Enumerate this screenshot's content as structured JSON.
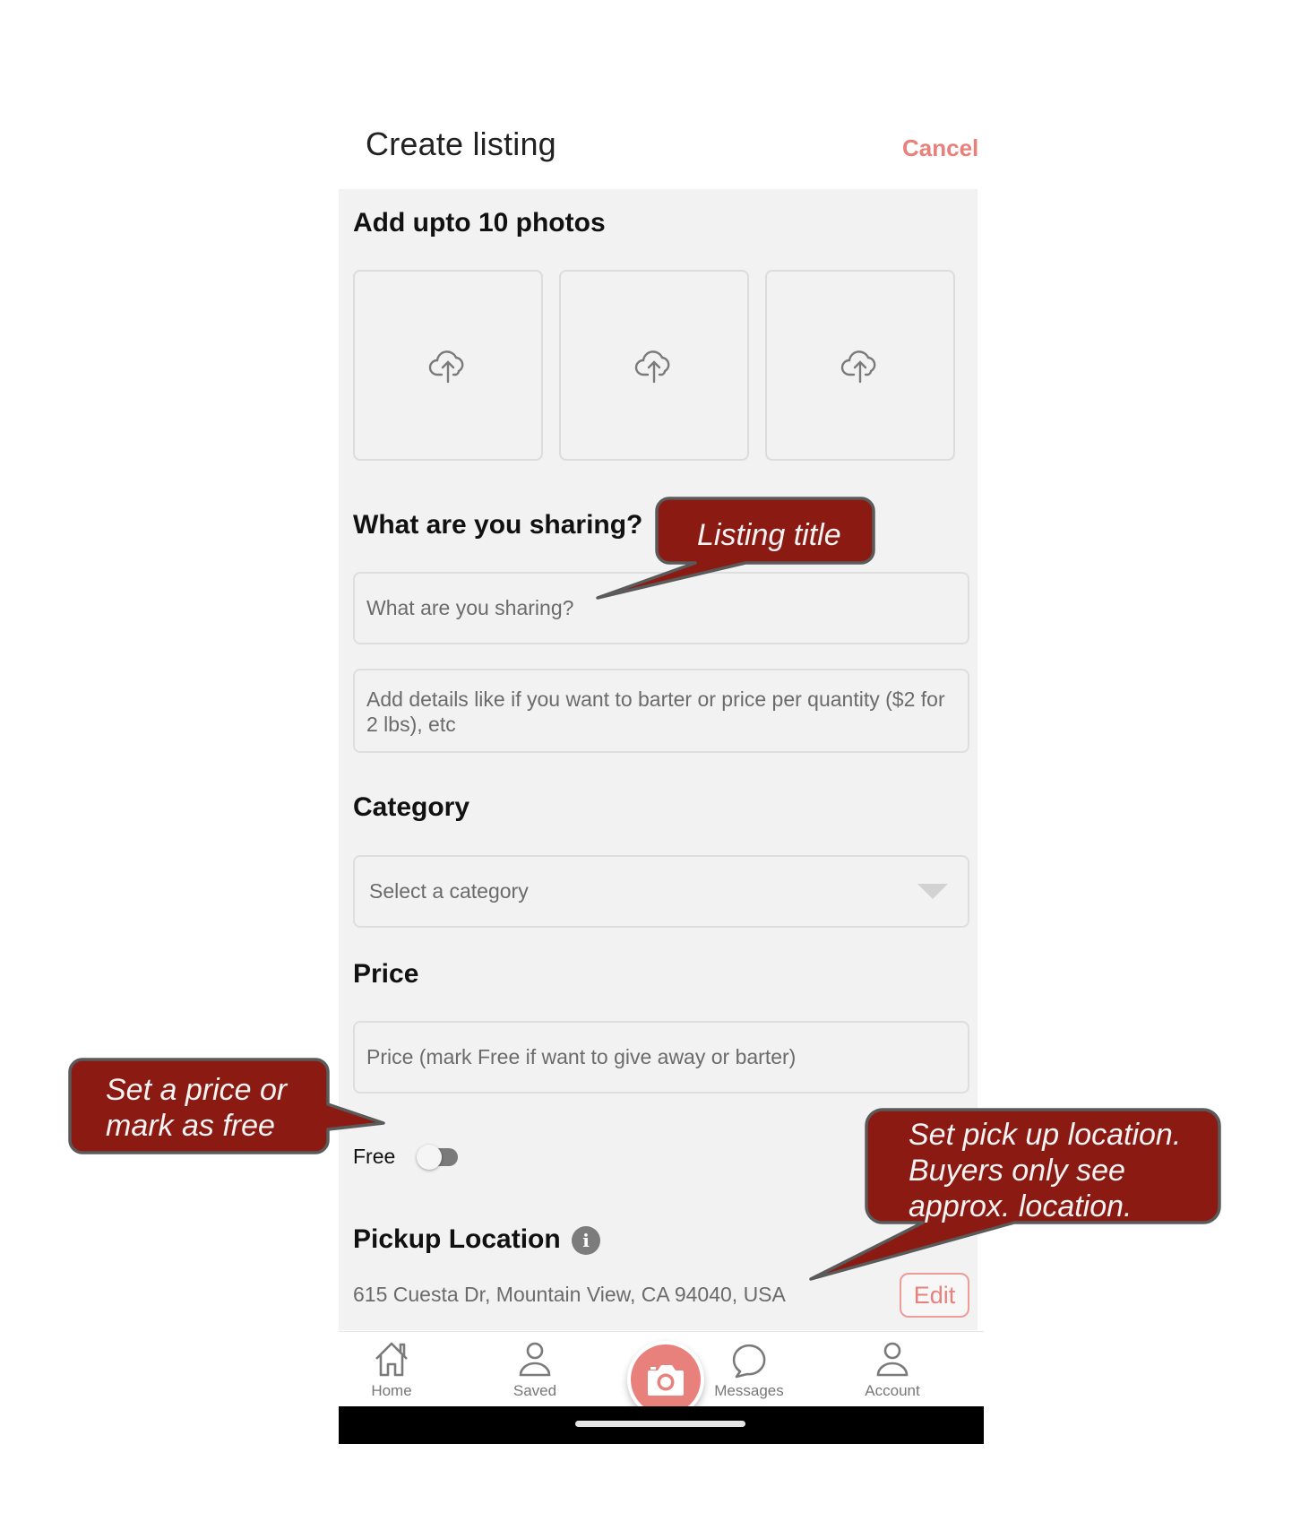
{
  "header": {
    "title": "Create listing",
    "cancel_label": "Cancel"
  },
  "photos": {
    "title": "Add upto 10 photos",
    "slots": [
      {
        "icon": "cloud-upload-icon"
      },
      {
        "icon": "cloud-upload-icon"
      },
      {
        "icon": "cloud-upload-icon"
      }
    ]
  },
  "sharing": {
    "title": "What are you sharing?",
    "title_input_placeholder": "What are you sharing?",
    "details_input_placeholder": "Add details like if you want to barter or price per quantity ($2 for 2 lbs), etc"
  },
  "category": {
    "title": "Category",
    "select_placeholder": "Select a category"
  },
  "price": {
    "title": "Price",
    "input_placeholder": "Price (mark Free if want to give away or barter)",
    "free_label": "Free",
    "free_toggle_on": false
  },
  "pickup": {
    "title": "Pickup Location",
    "info_icon": "i",
    "address": "615 Cuesta Dr, Mountain View, CA 94040, USA",
    "edit_label": "Edit"
  },
  "nav": {
    "items": [
      {
        "label": "Home",
        "icon": "home-icon"
      },
      {
        "label": "Saved",
        "icon": "person-icon"
      },
      {
        "label": "Messages",
        "icon": "chat-bubble-icon"
      },
      {
        "label": "Account",
        "icon": "person-icon"
      }
    ],
    "center_button_icon": "camera-icon"
  },
  "callouts": {
    "listing_title": "Listing title",
    "price_line1": "Set a price or",
    "price_line2": "mark as free",
    "pickup_line1": "Set pick up location.",
    "pickup_line2": "Buyers only see",
    "pickup_line3": "approx. location."
  },
  "colors": {
    "accent": "#e8817c",
    "panel_bg": "#f2f2f2",
    "callout_fill": "#8b1a12",
    "callout_border": "#5a5a5a"
  }
}
